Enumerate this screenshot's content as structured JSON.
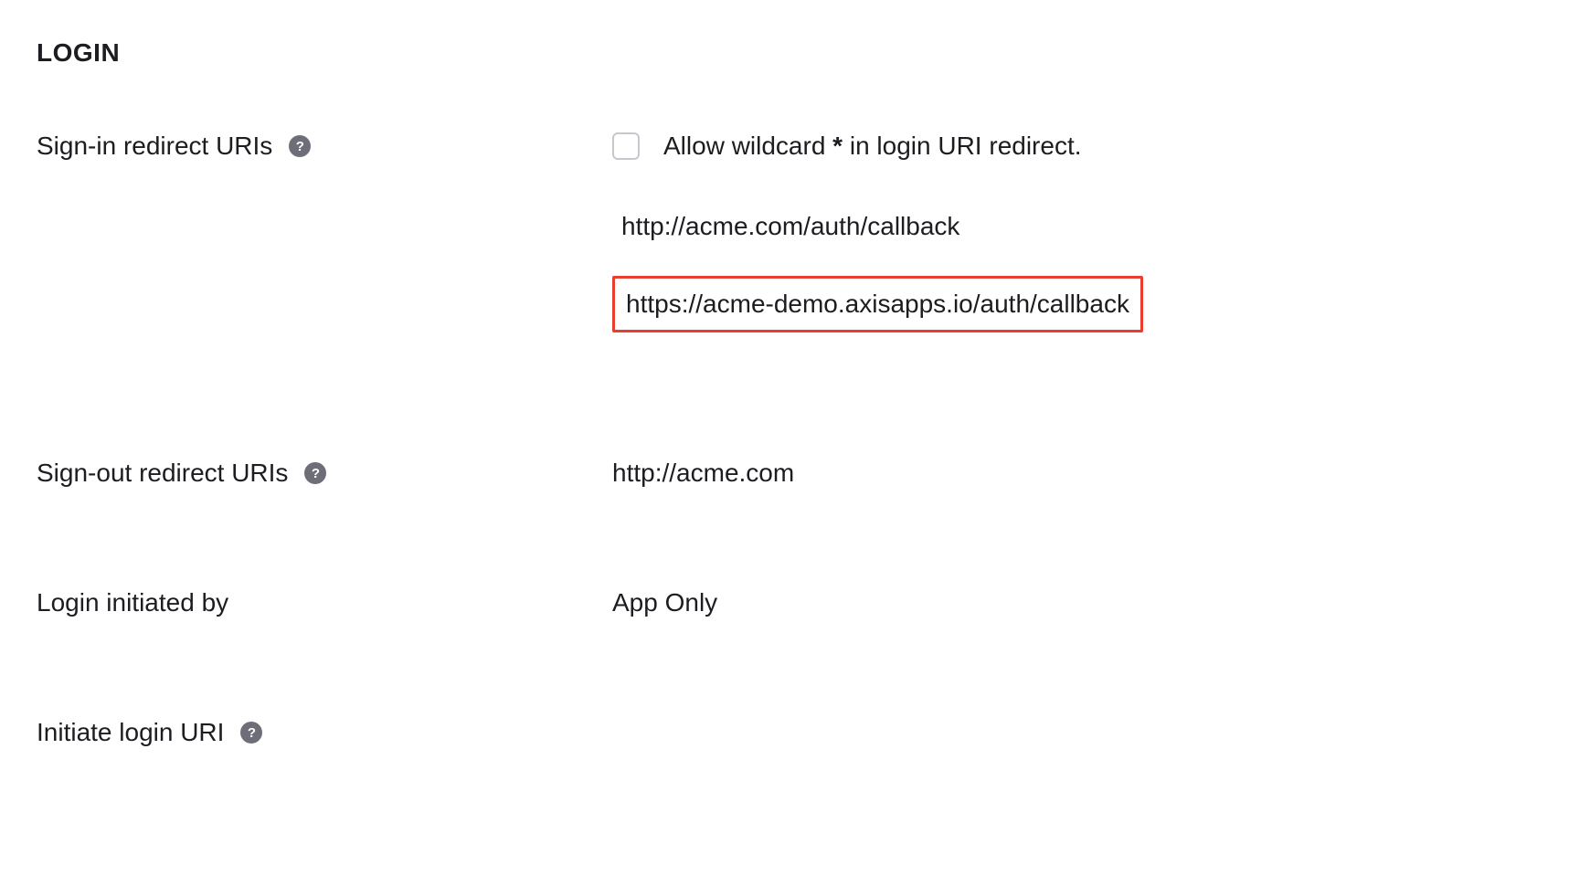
{
  "section": {
    "heading": "LOGIN"
  },
  "fields": {
    "signin_redirect": {
      "label": "Sign-in redirect URIs",
      "wildcard_checkbox_label_pre": "Allow wildcard ",
      "wildcard_star": "*",
      "wildcard_checkbox_label_post": " in login URI redirect.",
      "uris": [
        "http://acme.com/auth/callback",
        "https://acme-demo.axisapps.io/auth/callback"
      ]
    },
    "signout_redirect": {
      "label": "Sign-out redirect URIs",
      "value": "http://acme.com"
    },
    "login_initiated": {
      "label": "Login initiated by",
      "value": "App Only"
    },
    "initiate_login_uri": {
      "label": "Initiate login URI"
    }
  }
}
